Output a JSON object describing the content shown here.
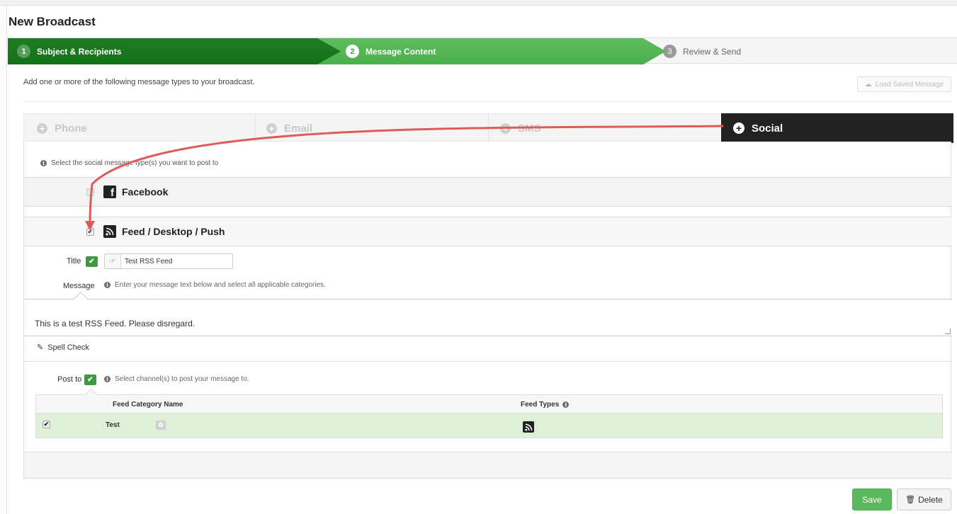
{
  "page": {
    "title": "New Broadcast"
  },
  "steps": [
    {
      "num": "1",
      "label": "Subject & Recipients",
      "state": "done"
    },
    {
      "num": "2",
      "label": "Message Content",
      "state": "active"
    },
    {
      "num": "3",
      "label": "Review & Send",
      "state": "pending"
    }
  ],
  "intro": "Add one or more of the following message types to your broadcast.",
  "load_saved_label": "Load Saved Message",
  "tabs": {
    "phone": "Phone",
    "email": "Email",
    "sms": "SMS",
    "social": "Social"
  },
  "social": {
    "info": "Select the social message type(s) you want to post to",
    "facebook": {
      "label": "Facebook",
      "checked": false
    },
    "feed": {
      "label": "Feed / Desktop / Push",
      "checked": true
    }
  },
  "form": {
    "title_label": "Title",
    "title_value": "Test RSS Feed",
    "message_label": "Message",
    "message_hint": "Enter your message text below and select all applicable categories.",
    "message_text": "This is a test RSS Feed. Please disregard.",
    "spell_check": "Spell Check",
    "post_to_label": "Post to",
    "post_to_hint": "Select channel(s) to post your message to."
  },
  "feed_table": {
    "columns": [
      "Feed Category Name",
      "Feed Types"
    ],
    "rows": [
      {
        "checked": true,
        "name": "Test"
      }
    ]
  },
  "actions": {
    "save": "Save",
    "delete": "Delete"
  },
  "colors": {
    "step_done": "#16701b",
    "step_active": "#5cb85c",
    "social_tab": "#222222",
    "row_selected": "#dff0d8",
    "annotation_arrow": "#e05a5a"
  }
}
